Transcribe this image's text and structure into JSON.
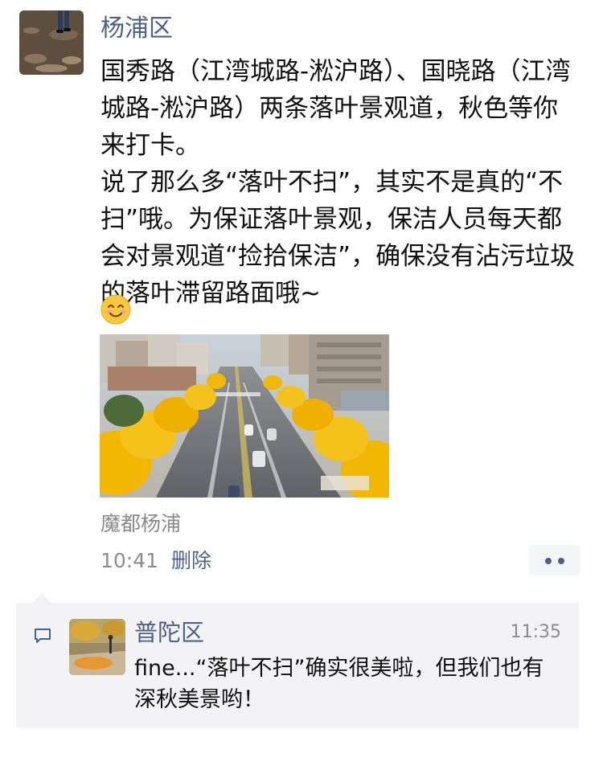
{
  "post": {
    "author": "杨浦区",
    "text": "国秀路（江湾城路-淞沪路）、国晓路（江湾城路-淞沪路）两条落叶景观道，秋色等你来打卡。\n说了那么多“落叶不扫”，其实不是真的“不扫”哦。为保证落叶景观，保洁人员每天都会对景观道“捡拾保洁”，确保没有沾污垃圾的落叶滞留路面哦~",
    "emoji": "smiling-face-emoji",
    "image": "tree-lined-avenue-photo",
    "source": "魔都杨浦",
    "time": "10:41",
    "delete_label": "删除"
  },
  "comment": {
    "icon": "comment-icon",
    "author": "普陀区",
    "time": "11:35",
    "text": "fine...“落叶不扫”确实很美啦，但我们也有深秋美景哟！"
  },
  "colors": {
    "link": "#4d6189",
    "text": "#111111",
    "meta": "#8c8c8c",
    "comment_bg": "#f3f3f5",
    "foliage": "#f2b705"
  }
}
